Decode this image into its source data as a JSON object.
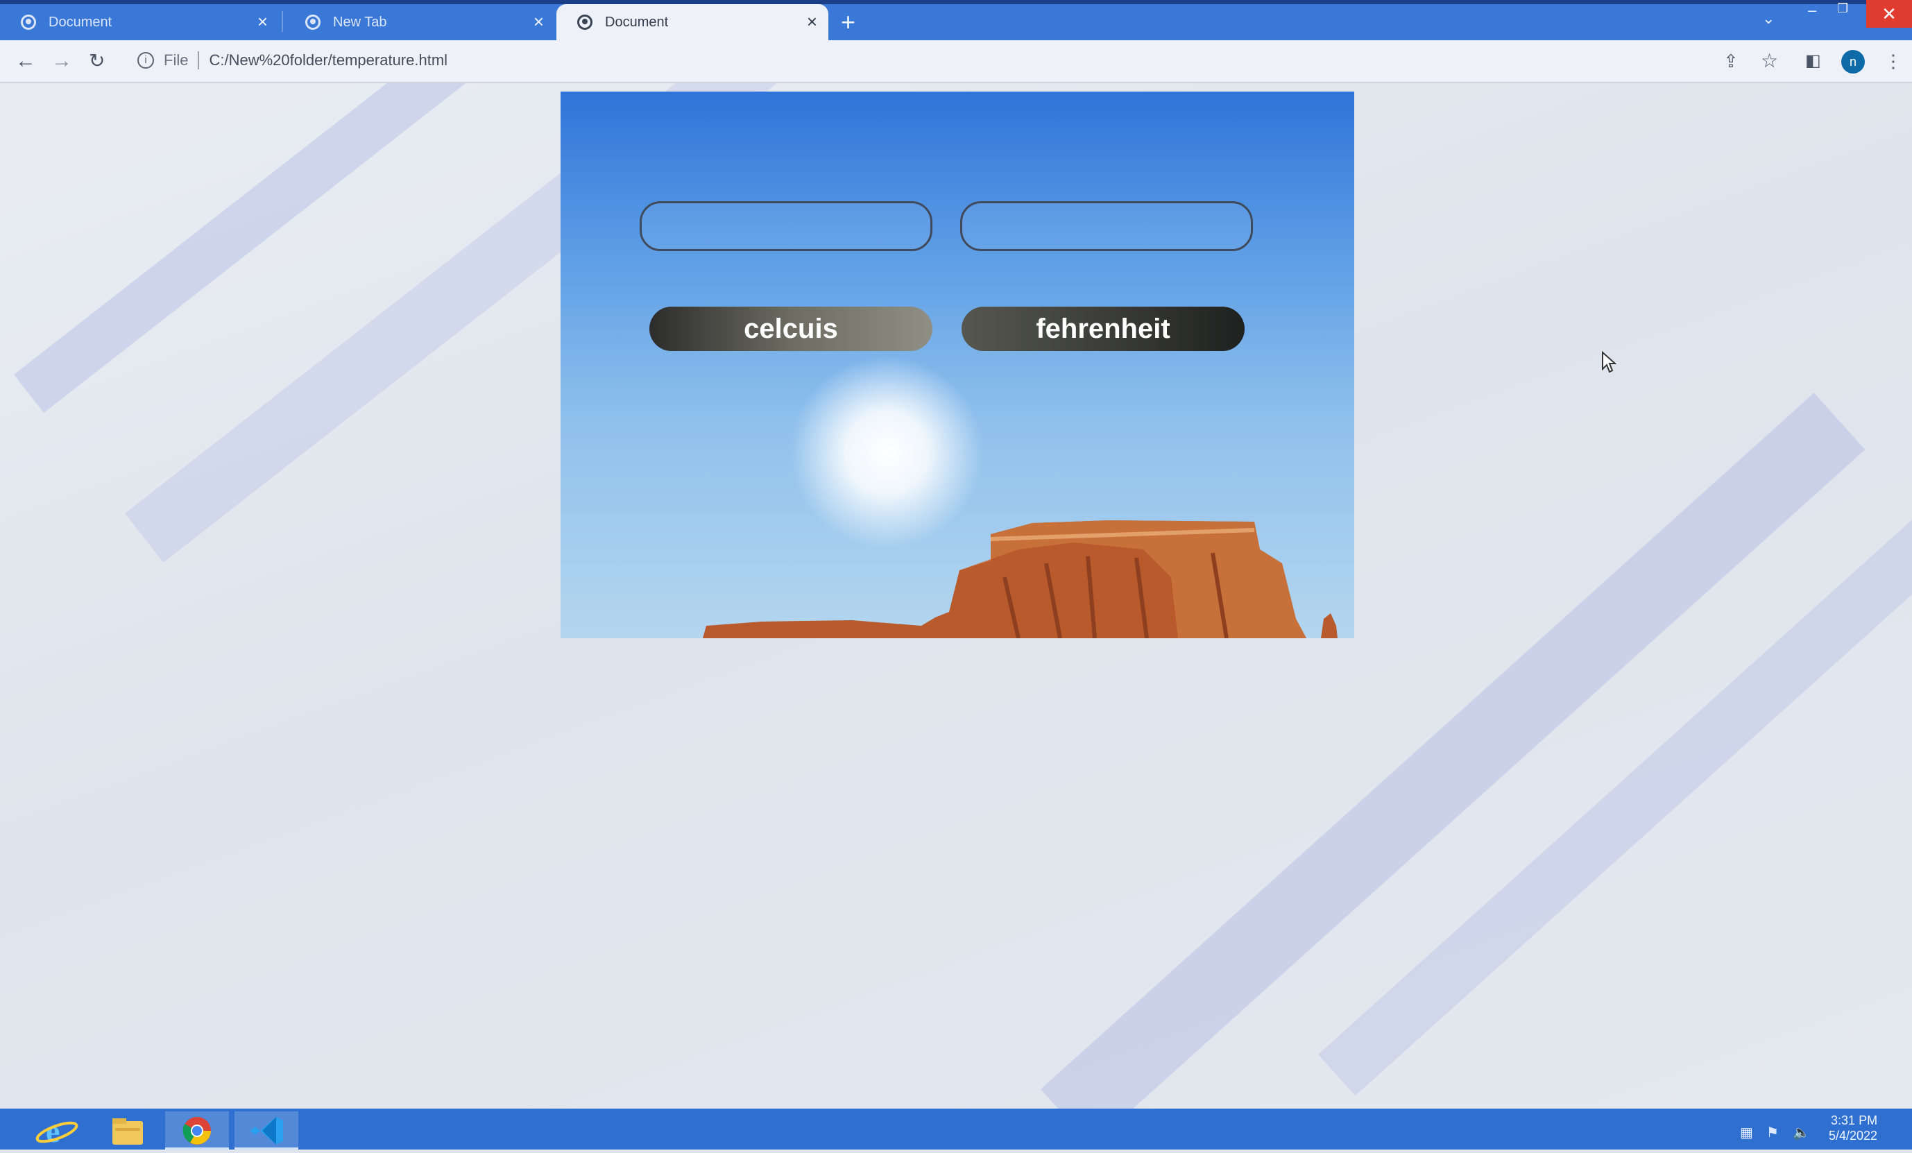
{
  "browser": {
    "tabs": [
      {
        "title": "Document",
        "active": false
      },
      {
        "title": "New Tab",
        "active": false
      },
      {
        "title": "Document",
        "active": true
      }
    ],
    "address": {
      "scheme_label": "File",
      "url": "C:/New%20folder/temperature.html"
    },
    "profile_initial": "n"
  },
  "page": {
    "celsius_input": {
      "value": "",
      "placeholder": ""
    },
    "fahrenheit_input": {
      "value": "",
      "placeholder": ""
    },
    "buttons": {
      "celsius_label": "celcuis",
      "fahrenheit_label": "fehrenheit"
    }
  },
  "taskbar": {
    "apps": [
      "internet-explorer-icon",
      "file-explorer-icon",
      "chrome-icon",
      "vscode-icon"
    ],
    "clock": {
      "time": "3:31 PM",
      "date": "5/4/2022"
    }
  },
  "colors": {
    "tabstrip": "#3a78d8",
    "taskbar": "#2f6fd0",
    "close_button": "#e03b2f"
  }
}
